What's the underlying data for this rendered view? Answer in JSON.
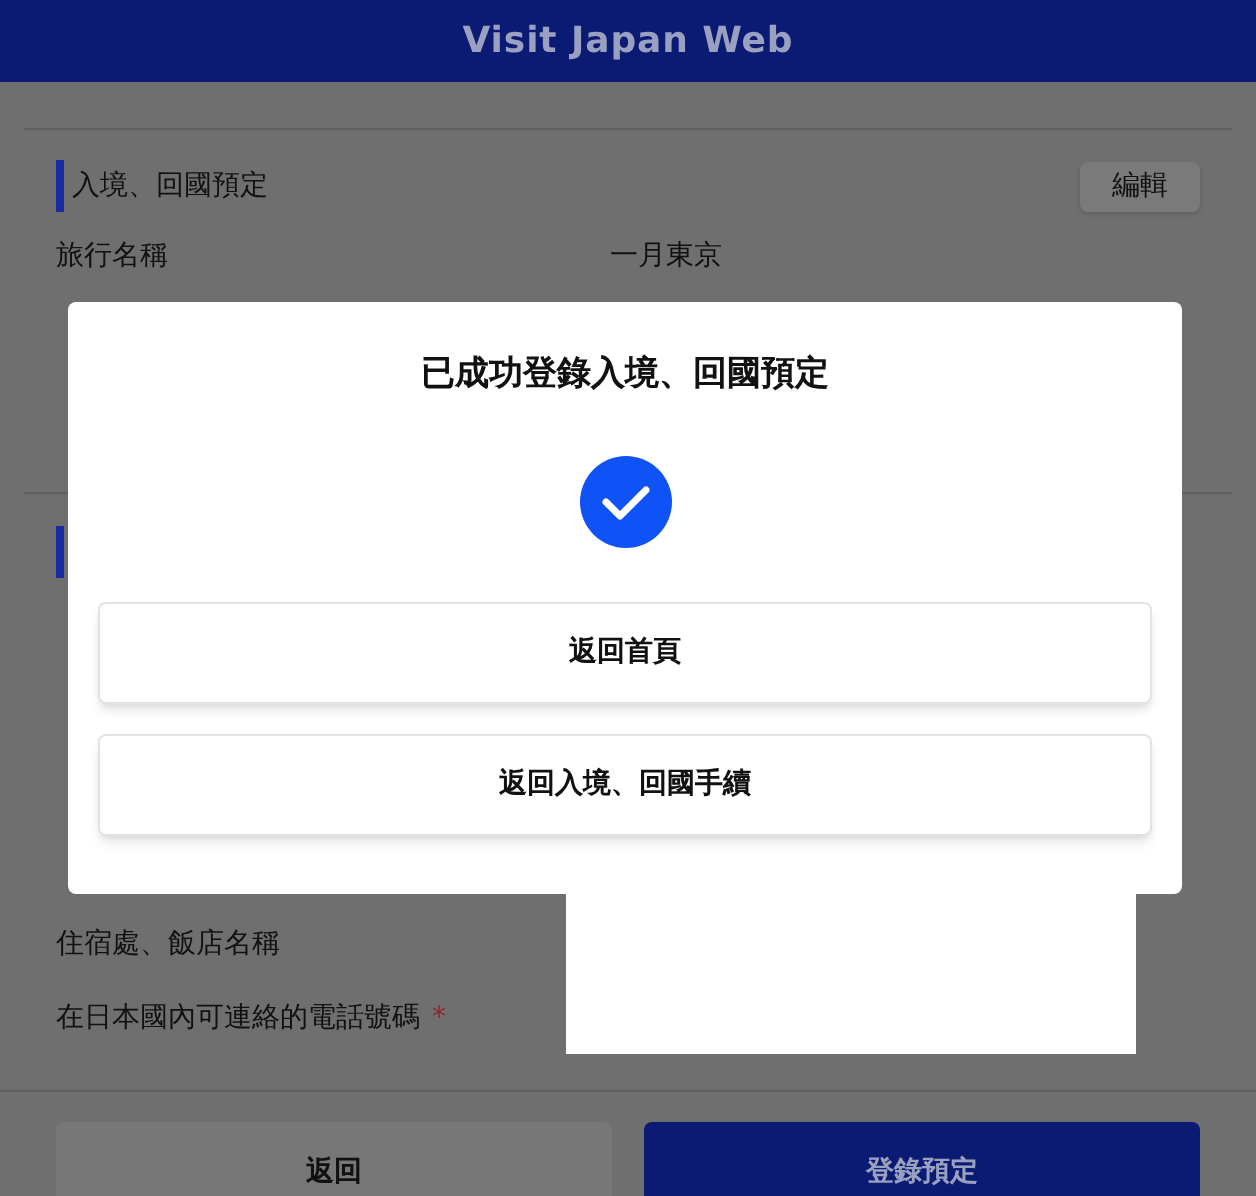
{
  "header": {
    "title": "Visit Japan Web"
  },
  "section": {
    "title": "入境、回國預定",
    "edit_button": "編輯",
    "rows": [
      {
        "label": "旅行名稱",
        "value": "一月東京"
      }
    ]
  },
  "fields": [
    {
      "label": "住宿處、飯店名稱"
    },
    {
      "label": "在日本國內可連絡的電話號碼",
      "required_mark": "*"
    }
  ],
  "dialog": {
    "title": "已成功登錄入境、回國預定",
    "buttons": [
      "返回首頁",
      "返回入境、回國手續"
    ]
  },
  "footer": {
    "buttons": [
      {
        "label": "返回",
        "kind": "secondary"
      },
      {
        "label": "登錄預定",
        "kind": "primary"
      }
    ]
  }
}
